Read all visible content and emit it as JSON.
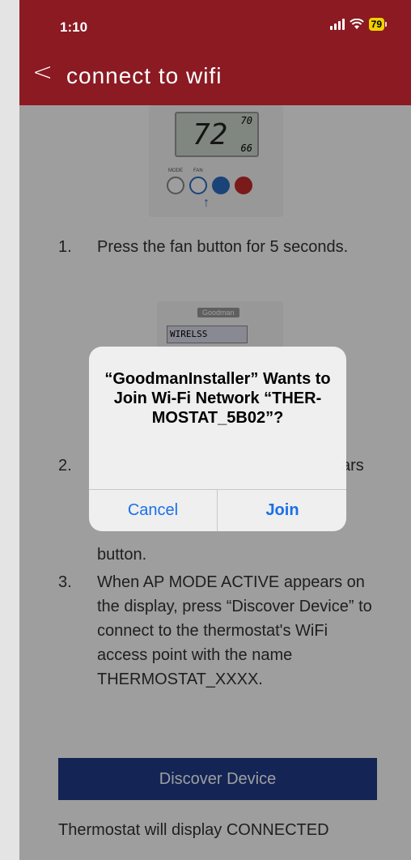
{
  "status_bar": {
    "time": "1:10",
    "battery": "79"
  },
  "header": {
    "back_glyph": "<",
    "title": "connect to wifi"
  },
  "thermostat_image": {
    "main_temp": "72",
    "setpoint_top": "70",
    "setpoint_bottom": "66",
    "mode_label": "MODE",
    "fan_label": "FAN"
  },
  "steps": [
    {
      "number": "1.",
      "text": "Press the fan button for 5 seconds."
    },
    {
      "number": "2.",
      "text": "ars"
    },
    {
      "number": "",
      "text": "button."
    },
    {
      "number": "3.",
      "text": "When AP MODE ACTIVE appears on the display, press “Discover Device” to connect to the thermostat's WiFi access point with the name THERMOSTAT_XXXX."
    }
  ],
  "thermostat_image_2": {
    "brand": "Goodman",
    "lcd_text": "WIRELSS"
  },
  "discover_button": "Discover Device",
  "footer_text": "Thermostat will display CONNECTED",
  "alert": {
    "title": "“GoodmanInstaller” Wants to Join Wi-Fi Network “THER-MOSTAT_5B02”?",
    "cancel": "Cancel",
    "join": "Join"
  },
  "colors": {
    "header": "#8b1a22",
    "discover": "#1f3a8a",
    "alert_button": "#1a6fe8"
  }
}
